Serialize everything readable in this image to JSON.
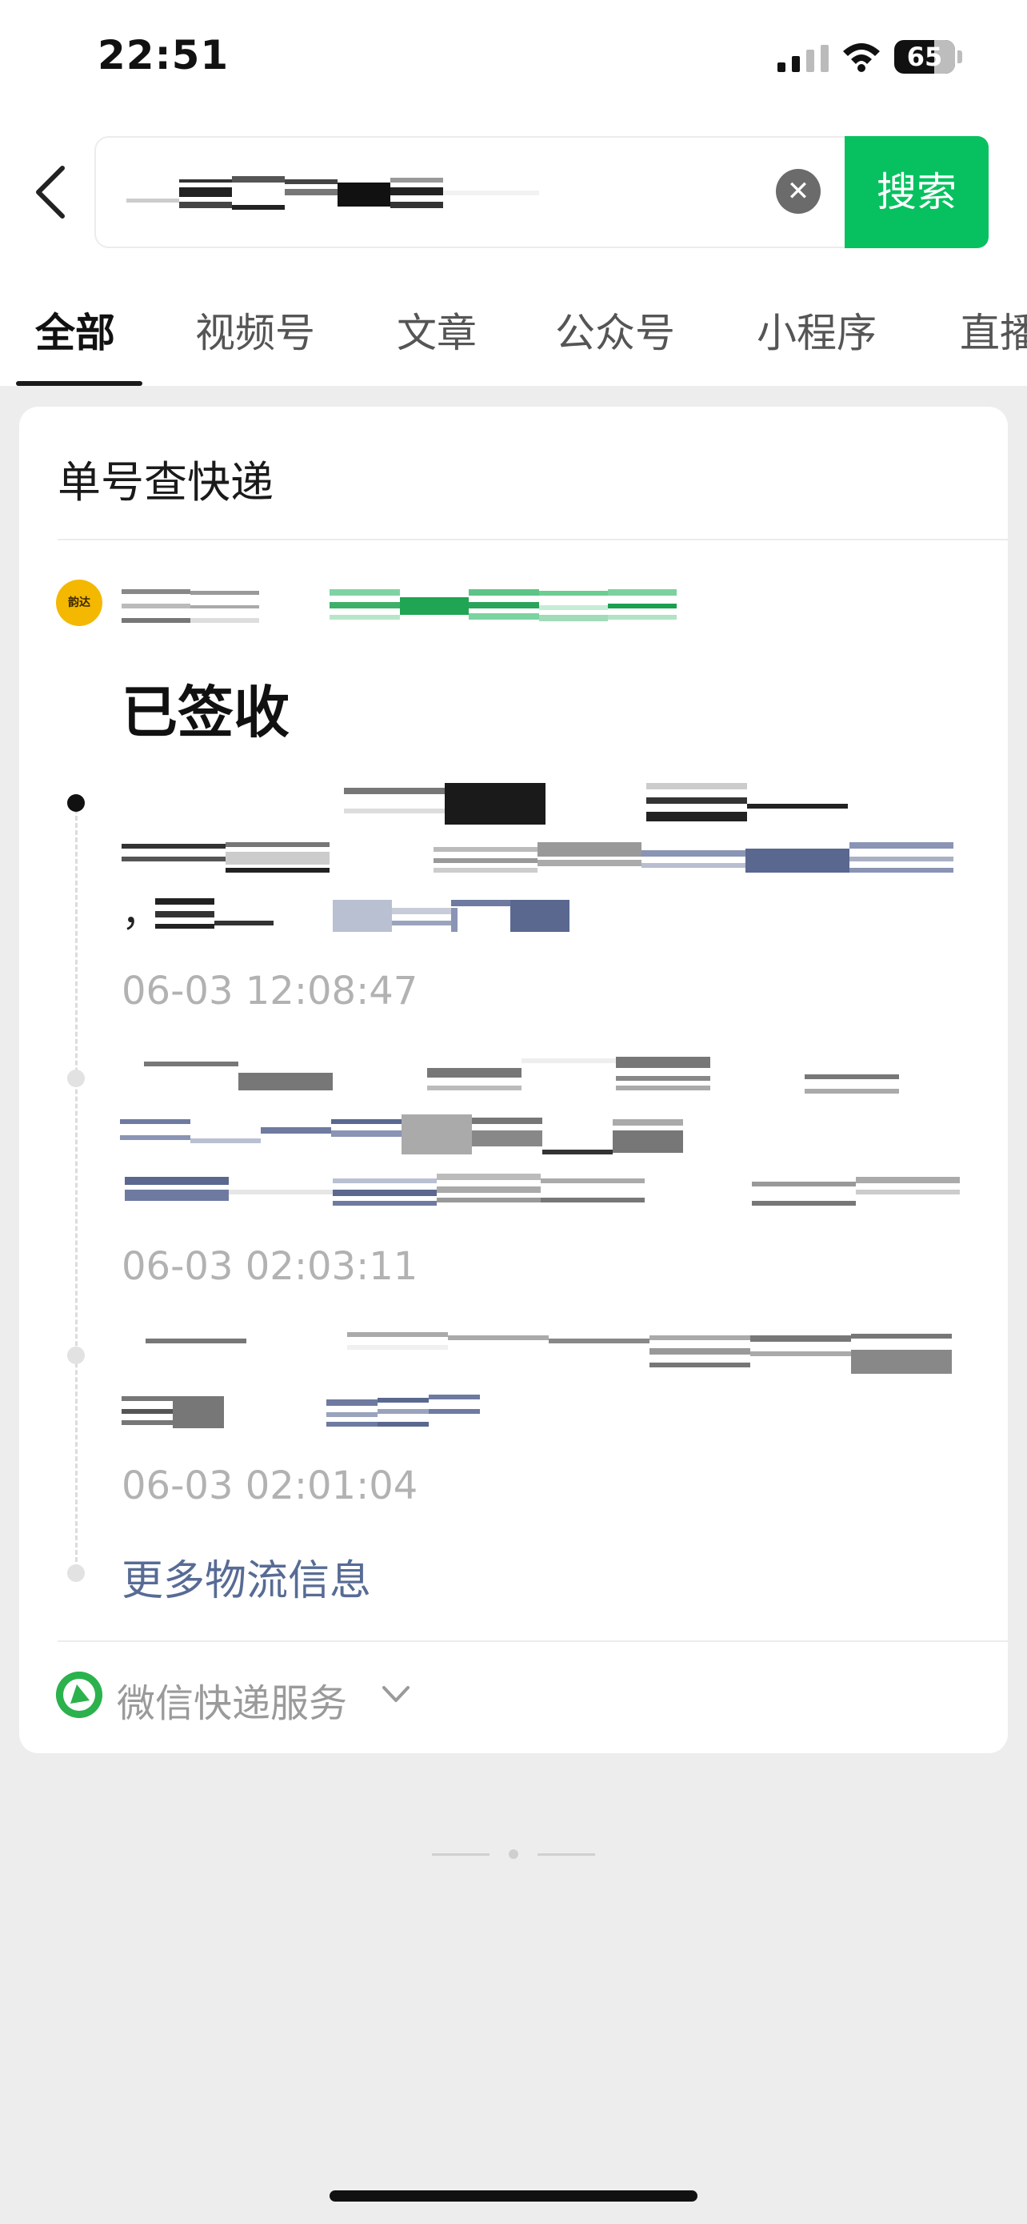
{
  "status_bar": {
    "time": "22:51",
    "battery": "65"
  },
  "search": {
    "submit_label": "搜索",
    "clear_icon": "✕"
  },
  "tabs": [
    {
      "label": "全部",
      "active": true
    },
    {
      "label": "视频号"
    },
    {
      "label": "文章"
    },
    {
      "label": "公众号"
    },
    {
      "label": "小程序"
    },
    {
      "label": "直播"
    }
  ],
  "card": {
    "title": "单号查快递",
    "carrier_logo_text": "韵达",
    "status": "已签收",
    "events": [
      {
        "prefix": "，",
        "time": "06-03 12:08:47"
      },
      {
        "time": "06-03 02:03:11"
      },
      {
        "time": "06-03 02:01:04"
      }
    ],
    "more_label": "更多物流信息",
    "service_label": "微信快递服务"
  },
  "colors": {
    "accent": "#07c160",
    "link": "#576b95",
    "muted": "#b2b2b2"
  }
}
